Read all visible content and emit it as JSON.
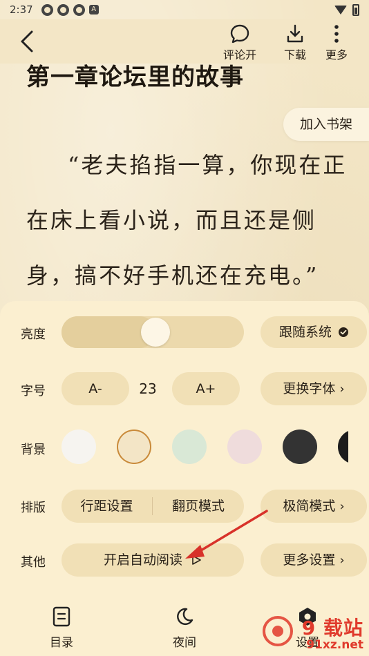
{
  "status_bar": {
    "time": "2:37",
    "a_icon": "A"
  },
  "top_bar": {
    "comment_label": "评论开",
    "download_label": "下载",
    "more_label": "更多"
  },
  "reader": {
    "chapter_title": "第一章论坛里的故事",
    "add_to_shelf": "加入书架",
    "lines": [
      "“老夫掐指一算，你现在正",
      "在床上看小说，而且还是侧",
      "身，搞不好手机还在充电。”"
    ]
  },
  "settings": {
    "brightness": {
      "label": "亮度",
      "level": 0.52,
      "follow_system": "跟随系统"
    },
    "font_size": {
      "label": "字号",
      "decrease": "A-",
      "value": "23",
      "increase": "A+",
      "change_font": "更换字体"
    },
    "background": {
      "label": "背景",
      "colors": [
        "#f6f4f0",
        "#f3e5c6",
        "#d9e8d6",
        "#efdcdc",
        "#333333",
        "#1c1c1c"
      ],
      "selected_index": 1
    },
    "layout": {
      "label": "排版",
      "line_spacing": "行距设置",
      "page_turn": "翻页模式",
      "simple_mode": "极简模式"
    },
    "other": {
      "label": "其他",
      "auto_read": "开启自动阅读",
      "more_settings": "更多设置"
    }
  },
  "bottom_nav": {
    "toc": "目录",
    "night": "夜间",
    "settings": "设置"
  },
  "watermark": {
    "line1": "9 载站",
    "line2": "91xz.net"
  },
  "colors": {
    "accent_red": "#d8322a",
    "panel_bg": "#fbefd0",
    "pill_bg": "#f1e0b6"
  }
}
